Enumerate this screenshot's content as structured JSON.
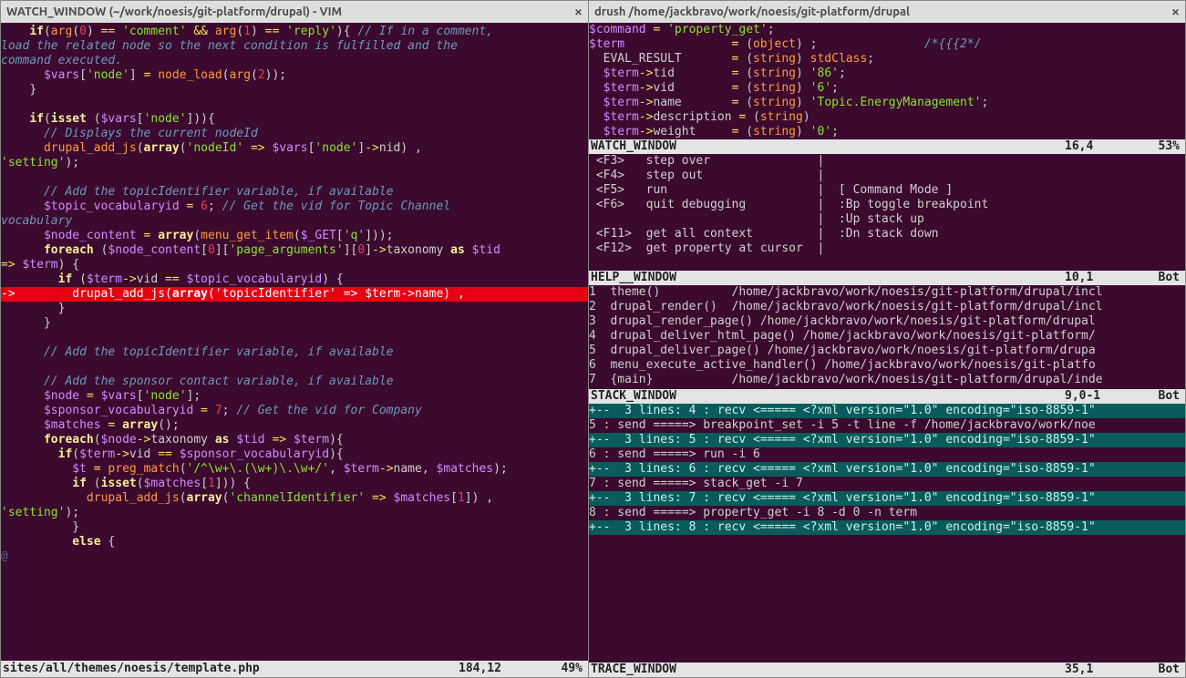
{
  "left": {
    "tab_title": "WATCH_WINDOW (~/work/noesis/git-platform/drupal) - VIM",
    "status_file": "sites/all/themes/noesis/template.php",
    "status_pos": "184,12",
    "status_pct": "49%"
  },
  "right": {
    "tab_title": "drush /home/jackbravo/work/noesis/git-platform/drupal",
    "watch": {
      "title": "WATCH_WINDOW",
      "pos": "16,4",
      "pct": "53%",
      "lines": {
        "cmd": "$command = 'property_get';",
        "term_head": "$term               = (object) ;               /*{{{2*/",
        "eval": "  EVAL_RESULT       = (string) stdClass;",
        "tid": "  $term->tid        = (string) '86';",
        "vid": "  $term->vid        = (string) '6';",
        "name": "  $term->name       = (string) 'Topic.EnergyManagement';",
        "desc": "  $term->description = (string)",
        "weight": "  $term->weight     = (string) '0';"
      }
    },
    "help": {
      "title": "HELP__WINDOW",
      "pos": "10,1",
      "pct": "Bot",
      "rows": [
        " <F3>   step over               |",
        " <F4>   step out                |",
        " <F5>   run                     |  [ Command Mode ]",
        " <F6>   quit debugging          |  :Bp toggle breakpoint",
        "                                |  :Up stack up",
        " <F11>  get all context         |  :Dn stack down",
        " <F12>  get property at cursor  |",
        ""
      ]
    },
    "stack": {
      "title": "STACK_WINDOW",
      "pos": "9,0-1",
      "pct": "Bot",
      "rows": [
        "1  theme()          /home/jackbravo/work/noesis/git-platform/drupal/incl",
        "2  drupal_render()  /home/jackbravo/work/noesis/git-platform/drupal/incl",
        "3  drupal_render_page() /home/jackbravo/work/noesis/git-platform/drupal",
        "4  drupal_deliver_html_page() /home/jackbravo/work/noesis/git-platform/",
        "5  drupal_deliver_page() /home/jackbravo/work/noesis/git-platform/drupa",
        "6  menu_execute_active_handler() /home/jackbravo/work/noesis/git-platfo",
        "7  {main}           /home/jackbravo/work/noesis/git-platform/drupal/inde"
      ]
    },
    "trace": {
      "title": "TRACE_WINDOW",
      "pos": "35,1",
      "pct": "Bot",
      "rows": [
        {
          "fold": true,
          "text": "+--  3 lines: 4 : recv <===== <?xml version=\"1.0\" encoding=\"iso-8859-1\""
        },
        {
          "fold": false,
          "text": "5 : send =====> breakpoint_set -i 5 -t line -f /home/jackbravo/work/noe"
        },
        {
          "fold": true,
          "text": "+--  3 lines: 5 : recv <===== <?xml version=\"1.0\" encoding=\"iso-8859-1\""
        },
        {
          "fold": false,
          "text": "6 : send =====> run -i 6"
        },
        {
          "fold": true,
          "text": "+--  3 lines: 6 : recv <===== <?xml version=\"1.0\" encoding=\"iso-8859-1\""
        },
        {
          "fold": false,
          "text": "7 : send =====> stack_get -i 7"
        },
        {
          "fold": true,
          "text": "+--  3 lines: 7 : recv <===== <?xml version=\"1.0\" encoding=\"iso-8859-1\""
        },
        {
          "fold": false,
          "text": "8 : send =====> property_get -i 8 -d 0 -n term"
        },
        {
          "fold": true,
          "text": "+--  3 lines: 8 : recv <===== <?xml version=\"1.0\" encoding=\"iso-8859-1\""
        }
      ]
    }
  },
  "code": {
    "l1": "    if(arg(0) == 'comment' && arg(1) == 'reply'){ // If in a comment,",
    "l2": "load the related node so the next condition is fulfilled and the",
    "l3": "command executed.",
    "l4": "      $vars['node'] = node_load(arg(2));",
    "l5": "    }",
    "l6": "",
    "l7": "    if(isset ($vars['node'])){",
    "l8": "      // Displays the current nodeId",
    "l9": "      drupal_add_js(array('nodeId' => $vars['node']->nid) ,",
    "l10": "'setting');",
    "l11": "",
    "l12": "      // Add the topicIdentifier variable, if available",
    "l13": "      $topic_vocabularyid = 6; // Get the vid for Topic Channel",
    "l14": "vocabulary",
    "l15": "      $node_content = array(menu_get_item($_GET['q']));",
    "l16": "      foreach ($node_content[0]['page_arguments'][0]->taxonomy as $tid",
    "l17": "=> $term) {",
    "l18": "        if ($term->vid == $topic_vocabularyid) {",
    "l19a": "->",
    "l19": "          drupal_add_js(array('topicIdentifier' => $term->name) ,",
    "l20": "'setting');",
    "l21": "        }",
    "l22": "      }",
    "l23": "",
    "l24": "      // Add the topicIdentifier variable, if available",
    "l25": "",
    "l26": "      // Add the sponsor contact variable, if available",
    "l27": "      $node = $vars['node'];",
    "l28": "      $sponsor_vocabularyid = 7; // Get the vid for Company",
    "l29": "      $matches = array();",
    "l30": "      foreach($node->taxonomy as $tid => $term){",
    "l31": "        if($term->vid == $sponsor_vocabularyid){",
    "l32": "          $t = preg_match('/^\\\\w+\\\\.(\\\\w+)\\\\.\\\\w+/', $term->name, $matches);",
    "l33": "          if (isset($matches[1])) {",
    "l34": "            drupal_add_js(array('channelIdentifier' => $matches[1]) ,",
    "l35": "'setting');",
    "l36": "          }",
    "l37": "          else {",
    "l38": "@"
  }
}
